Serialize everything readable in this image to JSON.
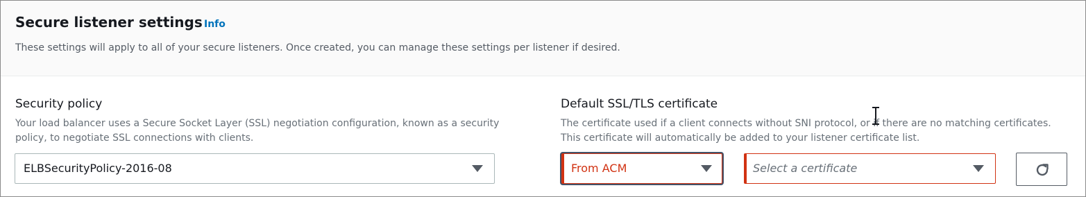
{
  "section": {
    "title": "Secure listener settings",
    "info_link": "Info",
    "description": "These settings will apply to all of your secure listeners. Once created, you can manage these settings per listener if desired."
  },
  "security_policy": {
    "label": "Security policy",
    "description": "Your load balancer uses a Secure Socket Layer (SSL) negotiation configuration, known as a security policy, to negotiate SSL connections with clients.",
    "selected_value": "ELBSecurityPolicy-2016-08",
    "caret_icon": "caret-down-icon"
  },
  "certificate": {
    "label": "Default SSL/TLS certificate",
    "description": "The certificate used if a client connects without SNI protocol, or if there are no matching certificates. This certificate will automatically be added to your listener certificate list.",
    "source_value": "From ACM",
    "certificate_placeholder": "Select a certificate",
    "refresh_icon": "refresh-icon",
    "error_color": "#d13212"
  },
  "colors": {
    "link": "#0073bb",
    "text": "#16191f",
    "secondary_text": "#687078",
    "error": "#d13212"
  }
}
